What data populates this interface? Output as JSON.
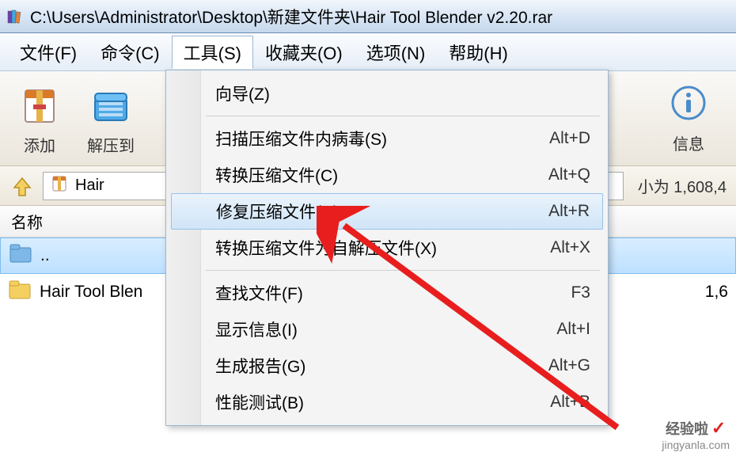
{
  "title": "C:\\Users\\Administrator\\Desktop\\新建文件夹\\Hair Tool Blender v2.20.rar",
  "menu": {
    "file": "文件(F)",
    "command": "命令(C)",
    "tools": "工具(S)",
    "favorites": "收藏夹(O)",
    "options": "选项(N)",
    "help": "帮助(H)"
  },
  "toolbar": {
    "add": "添加",
    "extract": "解压到",
    "info": "信息"
  },
  "path": {
    "archive_name": "Hair",
    "size_text": "小为 1,608,4"
  },
  "columns": {
    "name": "名称"
  },
  "rows": {
    "updir": "..",
    "folder": "Hair Tool Blen",
    "folder_size": "1,6"
  },
  "dropdown": {
    "wizard": "向导(Z)",
    "scan_virus": "扫描压缩文件内病毒(S)",
    "scan_virus_sc": "Alt+D",
    "convert": "转换压缩文件(C)",
    "convert_sc": "Alt+Q",
    "repair": "修复压缩文件(R)",
    "repair_sc": "Alt+R",
    "to_sfx": "转换压缩文件为自解压文件(X)",
    "to_sfx_sc": "Alt+X",
    "find": "查找文件(F)",
    "find_sc": "F3",
    "show_info": "显示信息(I)",
    "show_info_sc": "Alt+I",
    "report": "生成报告(G)",
    "report_sc": "Alt+G",
    "benchmark": "性能测试(B)",
    "benchmark_sc": "Alt+B"
  },
  "watermark": {
    "brand": "经验啦",
    "url": "jingyanla.com"
  }
}
